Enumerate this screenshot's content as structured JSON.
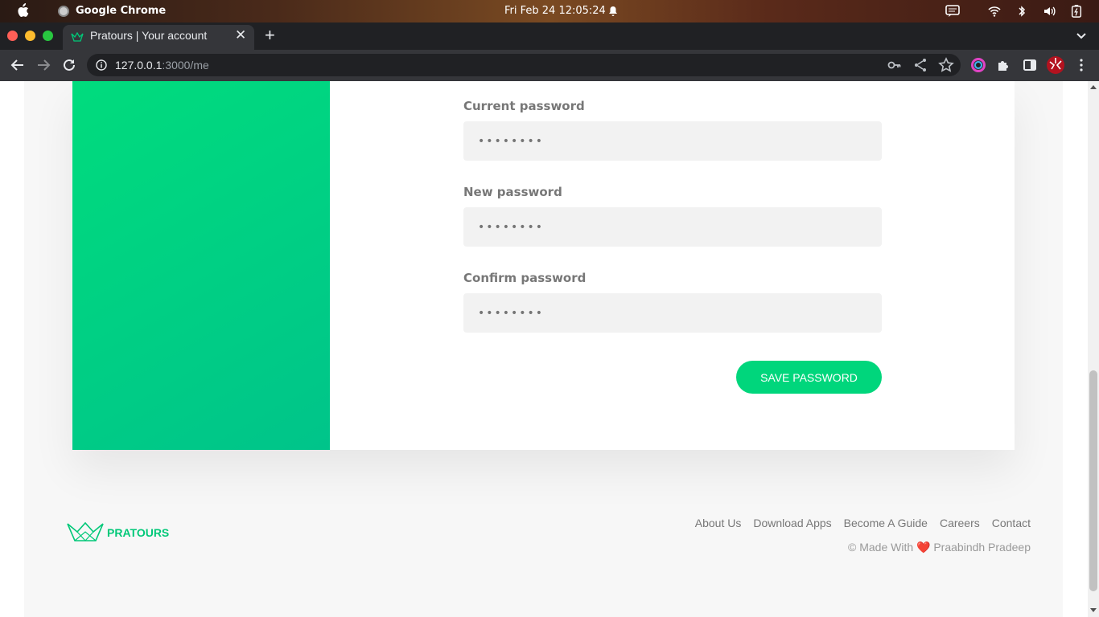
{
  "system_bar": {
    "app_name": "Google Chrome",
    "datetime": "Fri Feb 24  12:05:24"
  },
  "browser": {
    "tab_title": "Pratours | Your account",
    "url_host": "127.0.0.1",
    "url_path": ":3000/me",
    "close_glyph": "✕",
    "new_tab_glyph": "+"
  },
  "form": {
    "current_label": "Current password",
    "current_placeholder": "••••••••",
    "new_label": "New password",
    "new_placeholder": "••••••••",
    "confirm_label": "Confirm password",
    "confirm_placeholder": "••••••••",
    "save_label": "Save password"
  },
  "footer": {
    "brand": "PRATOURS",
    "nav": [
      "About Us",
      "Download Apps",
      "Become A Guide",
      "Careers",
      "Contact"
    ],
    "copy_prefix": "© Made With",
    "copy_heart": "❤️",
    "copy_author": "Praabindh Pradeep"
  },
  "colors": {
    "accent": "#00d67c",
    "sidebar_gradient_start": "#00dc7d",
    "sidebar_gradient_end": "#00c48a"
  }
}
